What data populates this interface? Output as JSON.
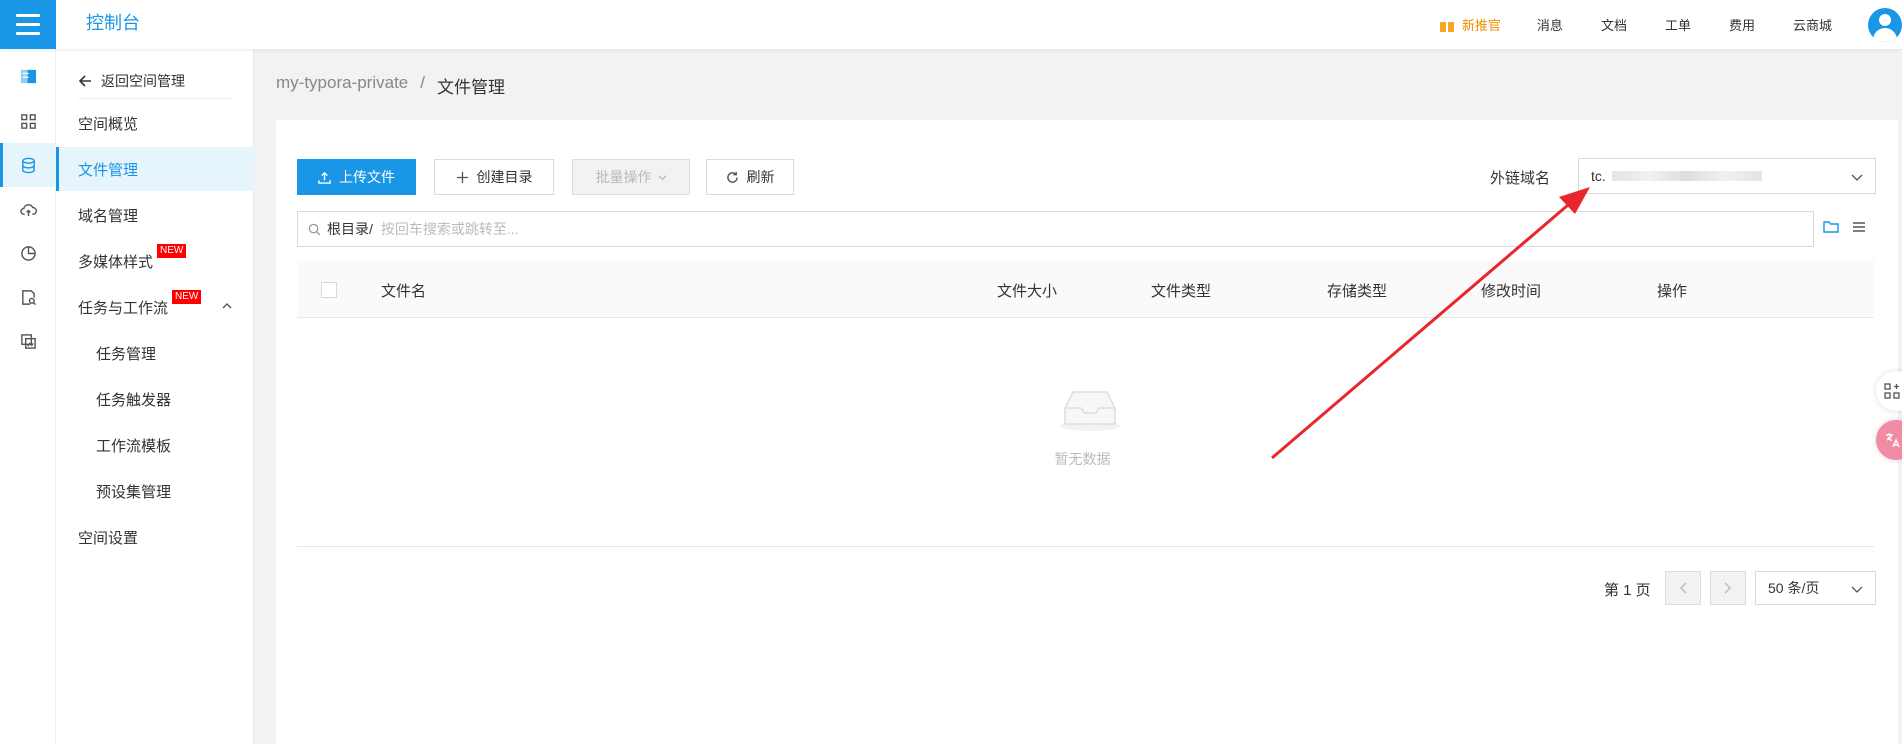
{
  "topbar": {
    "brand": "控制台",
    "promo": "新推官",
    "nav": [
      "消息",
      "文档",
      "工单",
      "费用",
      "云商城"
    ]
  },
  "sidebar": {
    "back": "返回空间管理",
    "items": [
      {
        "label": "空间概览"
      },
      {
        "label": "文件管理"
      },
      {
        "label": "域名管理"
      },
      {
        "label": "多媒体样式",
        "badge": "NEW"
      },
      {
        "label": "任务与工作流",
        "badge": "NEW"
      },
      {
        "label": "任务管理"
      },
      {
        "label": "任务触发器"
      },
      {
        "label": "工作流模板"
      },
      {
        "label": "预设集管理"
      },
      {
        "label": "空间设置"
      }
    ]
  },
  "breadcrumb": {
    "bucket": "my-typora-private",
    "sep": "/",
    "current": "文件管理"
  },
  "toolbar": {
    "upload": "上传文件",
    "mkdir": "创建目录",
    "batch": "批量操作",
    "refresh": "刷新",
    "domain_label": "外链域名",
    "domain_value": "tc."
  },
  "search": {
    "root": "根目录/",
    "placeholder": "按回车搜索或跳转至..."
  },
  "table": {
    "headers": [
      "文件名",
      "文件大小",
      "文件类型",
      "存储类型",
      "修改时间",
      "操作"
    ],
    "empty": "暂无数据"
  },
  "pagination": {
    "page": "第 1 页",
    "page_size": "50 条/页"
  },
  "colors": {
    "accent": "#1a96e6",
    "badge": "#ff0000",
    "annotation_arrow": "#e8262b"
  }
}
